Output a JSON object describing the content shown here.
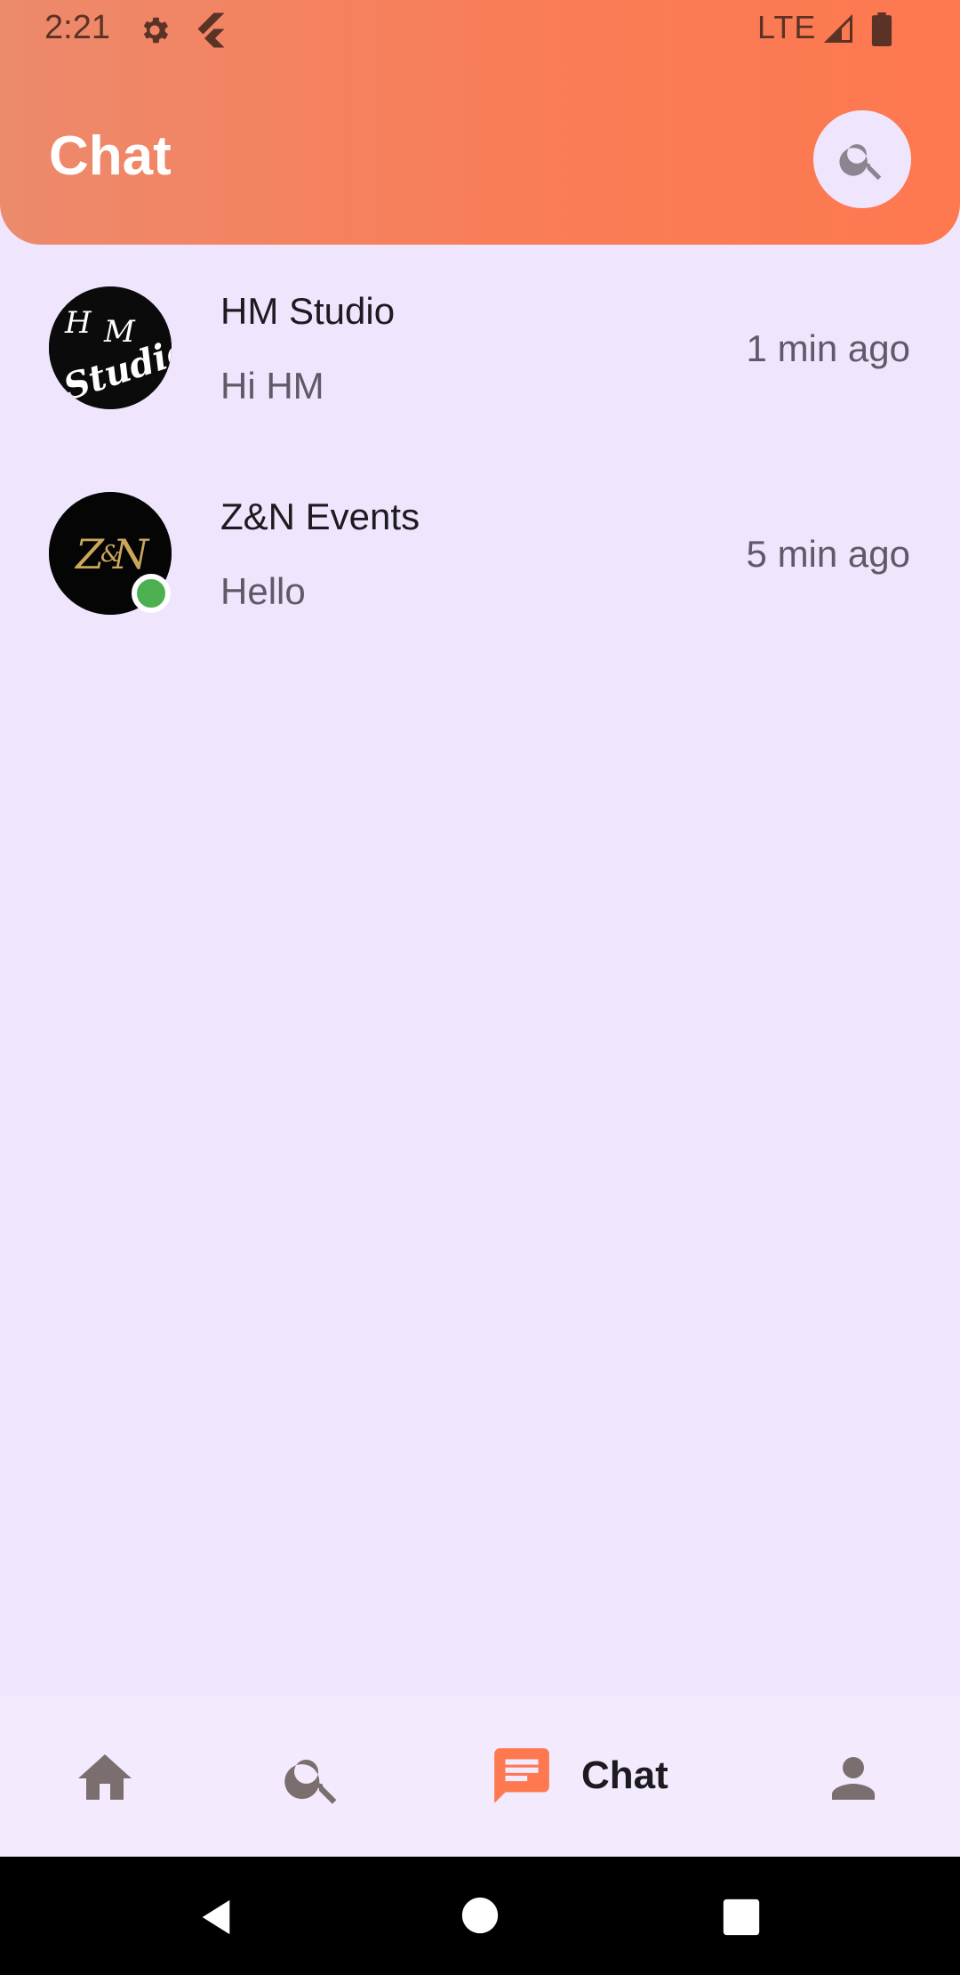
{
  "status_bar": {
    "time": "2:21",
    "network": "LTE",
    "icons": [
      "gear-icon",
      "flutter-icon",
      "signal-icon",
      "battery-icon"
    ]
  },
  "header": {
    "title": "Chat",
    "search_icon": "search-icon",
    "gradient_colors": [
      "#ec8a6c",
      "#fe7850"
    ]
  },
  "chats": [
    {
      "name": "HM Studio",
      "message": "Hi HM",
      "time": "1 min ago",
      "avatar_text": [
        "H",
        "M",
        "Studio"
      ],
      "online": false
    },
    {
      "name": "Z&N Events",
      "message": "Hello",
      "time": "5 min ago",
      "avatar_text": [
        "Z&N"
      ],
      "online": true
    }
  ],
  "bottom_nav": {
    "items": [
      {
        "icon": "home-icon",
        "label": "",
        "active": false
      },
      {
        "icon": "search-icon",
        "label": "",
        "active": false
      },
      {
        "icon": "chat-icon",
        "label": "Chat",
        "active": true
      },
      {
        "icon": "person-icon",
        "label": "",
        "active": false
      }
    ],
    "active_color": "#fe7850",
    "inactive_color": "#7a6e6e"
  },
  "system_nav": {
    "icons": [
      "back-icon",
      "home-circle-icon",
      "recents-icon"
    ]
  },
  "colors": {
    "background": "#efe5fc",
    "online": "#4caf50",
    "text_primary": "#1d1b20",
    "text_secondary": "#5f5968"
  }
}
